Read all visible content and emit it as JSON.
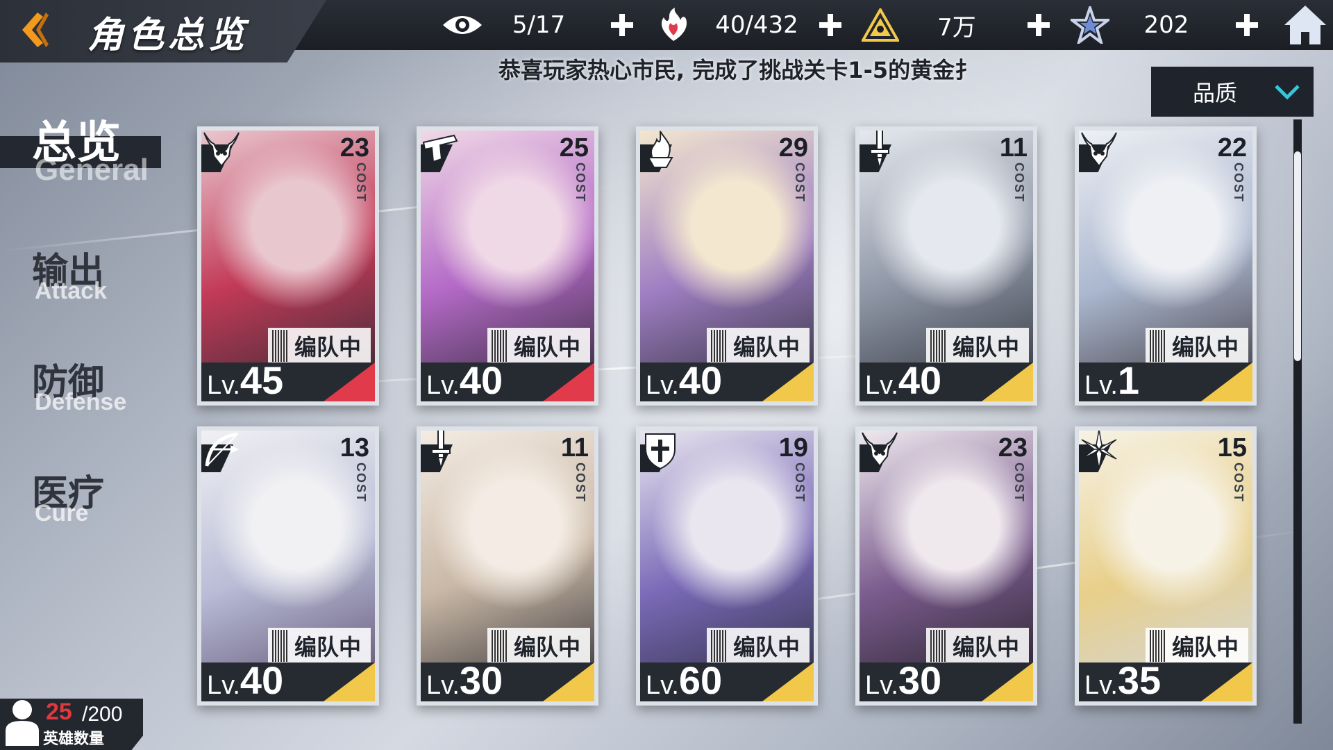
{
  "header": {
    "title": "角色总览",
    "resources": [
      {
        "icon": "eye-icon",
        "value": "5/17"
      },
      {
        "icon": "flame-heart-icon",
        "value": "40/432"
      },
      {
        "icon": "pyramid-icon",
        "value": "7万"
      },
      {
        "icon": "star-badge-icon",
        "value": "202"
      }
    ]
  },
  "marquee": "恭喜玩家热心市民, 完成了挑战关卡1-5的黄金扌",
  "sort": {
    "label": "品质"
  },
  "nav": {
    "items": [
      {
        "zh": "总览",
        "en": "General",
        "active": true
      },
      {
        "zh": "输出",
        "en": "Attack",
        "active": false
      },
      {
        "zh": "防御",
        "en": "Defense",
        "active": false
      },
      {
        "zh": "医疗",
        "en": "Cure",
        "active": false
      }
    ]
  },
  "cost_label": "COST",
  "team_tag": "编队中",
  "lv_prefix": "Lv.",
  "cards": [
    {
      "cost": "23",
      "level": "45",
      "class": "demon-horn-icon",
      "corner": "#e13a4b",
      "art": [
        "#e9c7cf",
        "#c23a57",
        "#2b2a33"
      ]
    },
    {
      "cost": "25",
      "level": "40",
      "class": "pistol-icon",
      "corner": "#e13a4b",
      "art": [
        "#f0d9e6",
        "#b46ac7",
        "#2a2630"
      ]
    },
    {
      "cost": "29",
      "level": "40",
      "class": "flame-icon",
      "corner": "#f1c84a",
      "art": [
        "#f3e7cf",
        "#9e7ec2",
        "#2a2b33"
      ]
    },
    {
      "cost": "11",
      "level": "40",
      "class": "sword-icon",
      "corner": "#f1c84a",
      "art": [
        "#e5e8ee",
        "#8f97a6",
        "#2c2f38"
      ]
    },
    {
      "cost": "22",
      "level": "1",
      "class": "demon-horn-icon",
      "corner": "#f1c84a",
      "art": [
        "#eef0f4",
        "#aab7cf",
        "#3a3337"
      ]
    },
    {
      "cost": "13",
      "level": "40",
      "class": "bow-icon",
      "corner": "#f1c84a",
      "art": [
        "#f1f1f4",
        "#b8bcd6",
        "#5a4a6c"
      ]
    },
    {
      "cost": "11",
      "level": "30",
      "class": "sword-icon",
      "corner": "#f1c84a",
      "art": [
        "#f4ece4",
        "#c9b8a6",
        "#2b2a30"
      ]
    },
    {
      "cost": "19",
      "level": "60",
      "class": "shield-icon",
      "corner": "#f1c84a",
      "art": [
        "#e9e6ef",
        "#7a6ab8",
        "#2a2b3a"
      ]
    },
    {
      "cost": "23",
      "level": "30",
      "class": "demon-horn-icon",
      "corner": "#f1c84a",
      "art": [
        "#efe9ee",
        "#7b5c8e",
        "#1f1d22"
      ]
    },
    {
      "cost": "15",
      "level": "35",
      "class": "snowflake-icon",
      "corner": "#f1c84a",
      "art": [
        "#f6f2e6",
        "#e8cf8a",
        "#cfd8e6"
      ]
    }
  ],
  "hero_count": {
    "current": "25",
    "max": "/200",
    "label": "英雄数量"
  },
  "colors": {
    "accent_orange": "#f39a1e",
    "rare_red": "#e13a4b",
    "gold": "#f1c84a",
    "panel_dark": "#1f232b"
  }
}
